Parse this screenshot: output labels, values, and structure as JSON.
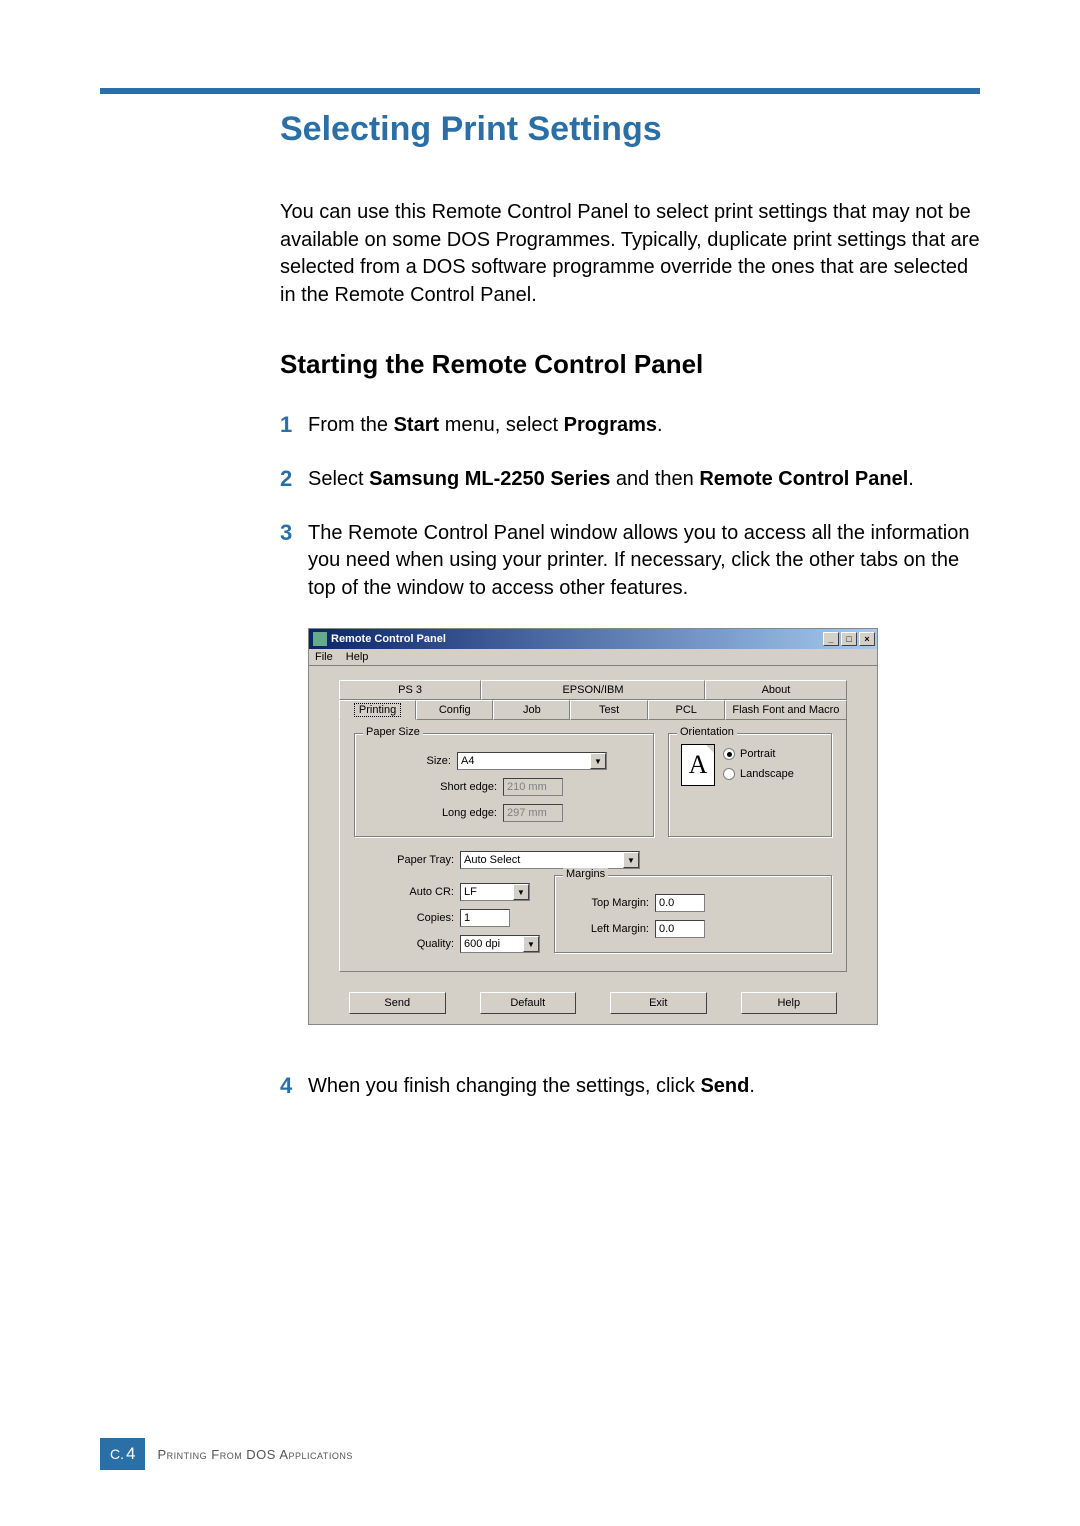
{
  "page": {
    "title": "Selecting Print Settings",
    "intro": "You can use this Remote Control Panel to select print settings that may not be available on some DOS Programmes. Typically, duplicate print settings that are selected from a DOS software programme override the ones that are selected in the Remote Control Panel.",
    "subtitle": "Starting the Remote Control Panel"
  },
  "steps": {
    "s1_a": "From the ",
    "s1_b": "Start",
    "s1_c": " menu, select ",
    "s1_d": "Programs",
    "s1_e": ".",
    "s2_a": "Select ",
    "s2_b": "Samsung ML-2250 Series",
    "s2_c": " and then ",
    "s2_d": "Remote Control Panel",
    "s2_e": ".",
    "s3": "The Remote Control Panel window allows you to access all the information you need when using your printer. If necessary, click the other tabs on the top of the window to access other features.",
    "s4_a": "When you finish changing the settings, click ",
    "s4_b": "Send",
    "s4_c": "."
  },
  "win": {
    "title": "Remote Control Panel",
    "menu_file": "File",
    "menu_help": "Help",
    "tabs_top": [
      "PS 3",
      "EPSON/IBM",
      "About"
    ],
    "tabs_bot": [
      "Printing",
      "Config",
      "Job",
      "Test",
      "PCL",
      "Flash Font and Macro"
    ],
    "paper_size": {
      "legend": "Paper Size",
      "size_label": "Size:",
      "size_value": "A4",
      "short_edge_label": "Short edge:",
      "short_edge_value": "210 mm",
      "long_edge_label": "Long edge:",
      "long_edge_value": "297 mm"
    },
    "orientation": {
      "legend": "Orientation",
      "icon_letter": "A",
      "portrait": "Portrait",
      "landscape": "Landscape"
    },
    "paper_tray_label": "Paper Tray:",
    "paper_tray_value": "Auto Select",
    "auto_cr_label": "Auto CR:",
    "auto_cr_value": "LF",
    "copies_label": "Copies:",
    "copies_value": "1",
    "quality_label": "Quality:",
    "quality_value": "600 dpi",
    "margins": {
      "legend": "Margins",
      "top_label": "Top Margin:",
      "top_value": "0.0",
      "left_label": "Left Margin:",
      "left_value": "0.0"
    },
    "buttons": {
      "send": "Send",
      "default": "Default",
      "exit": "Exit",
      "help": "Help"
    },
    "sysbuttons": {
      "min": "_",
      "max": "□",
      "close": "×"
    }
  },
  "footer": {
    "prefix": "C.",
    "num": "4",
    "text": "Printing From DOS Applications"
  }
}
